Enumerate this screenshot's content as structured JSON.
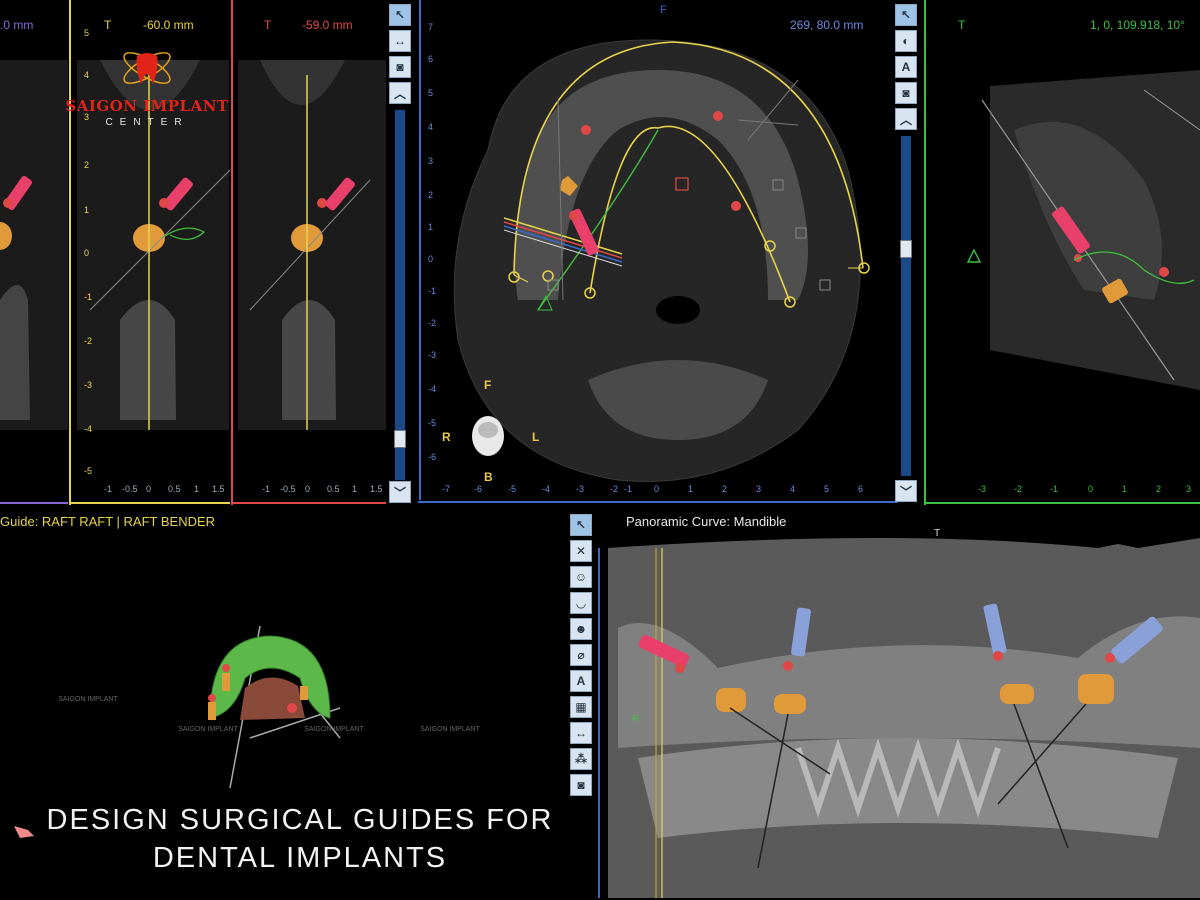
{
  "logo": {
    "brand": "SAIGON IMPLANT",
    "sub": "CENTER"
  },
  "views": {
    "cross1": {
      "pos_label": "T",
      "value": "-60.0 mm"
    },
    "cross0": {
      "value": ".0 mm"
    },
    "cross2": {
      "pos_label": "T",
      "value": "-59.0 mm"
    },
    "axial": {
      "top_label": "F",
      "readout": "269, 80.0 mm",
      "orient": {
        "front": "F",
        "right": "R",
        "left": "L",
        "back": "B"
      }
    },
    "sagittal": {
      "pos_label": "T",
      "readout": "1, 0, 109.918, 10°"
    },
    "guide": {
      "title": "Guide: RAFT RAFT | RAFT BENDER"
    },
    "panoramic": {
      "title": "Panoramic Curve: Mandible",
      "top_label": "T",
      "side_label": "R"
    }
  },
  "ticks": {
    "cross_h": [
      "-1",
      "-0.5",
      "0",
      "0.5",
      "1",
      "1.5"
    ],
    "axial_h": [
      "-7",
      "-6",
      "-5",
      "-4",
      "-3",
      "-2",
      "-1",
      "0",
      "1",
      "2",
      "3",
      "4",
      "5",
      "6"
    ],
    "axial_v": [
      "7",
      "6",
      "5",
      "4",
      "3",
      "2",
      "1",
      "0",
      "-1",
      "-2",
      "-3",
      "-4",
      "-5",
      "-6"
    ],
    "sag_h": [
      "-3",
      "-2",
      "-1",
      "0",
      "1",
      "2",
      "3"
    ],
    "cross_v": [
      "5",
      "4",
      "3",
      "2",
      "1",
      "0",
      "-1",
      "-2",
      "-3",
      "-4",
      "-5"
    ]
  },
  "toolbar_axial": [
    "select-icon",
    "view-icon",
    "annotation-icon",
    "camera-icon",
    "scroll-up-icon"
  ],
  "toolbar_cross": [
    "select-icon",
    "measure-icon",
    "camera-icon",
    "scroll-up-icon"
  ],
  "toolbar_pano": [
    "select-icon",
    "delete-icon",
    "skull-icon",
    "teeth-icon",
    "face-icon",
    "implant-icon",
    "annotation-icon",
    "grid-icon",
    "measure-icon",
    "cluster-icon",
    "camera-icon"
  ],
  "watermark": {
    "brand": "SAIGON IMPLANT",
    "sub": "CENTER"
  },
  "caption": {
    "line1": "DESIGN SURGICAL GUIDES FOR",
    "line2": "DENTAL IMPLANTS"
  },
  "colors": {
    "yellow": "#e8d44a",
    "green": "#3fbf3f",
    "red": "#e04848",
    "blue": "#3a6ad0",
    "implant_red": "#e8406a",
    "cap_orange": "#e09a3a"
  }
}
